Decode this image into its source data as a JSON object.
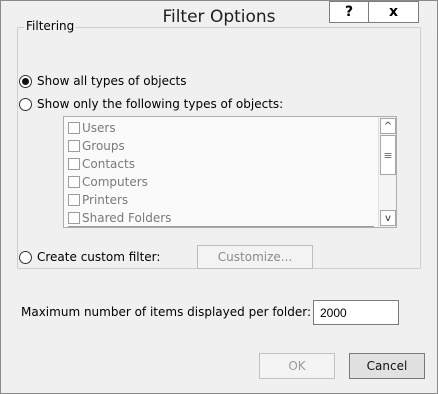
{
  "window": {
    "title": "Filter Options",
    "help_label": "?",
    "close_label": "x"
  },
  "filtering": {
    "group_label": "Filtering",
    "show_all_label": "Show all types of objects",
    "show_only_label": "Show only the following types of objects:",
    "selected_option": "show_all",
    "object_types": [
      "Users",
      "Groups",
      "Contacts",
      "Computers",
      "Printers",
      "Shared Folders"
    ],
    "custom_label": "Create custom filter:",
    "customize_label": "Customize...",
    "scroll_up_glyph": "^",
    "scroll_thumb_glyph": "≡",
    "scroll_down_glyph": "v"
  },
  "max_items": {
    "label": "Maximum number of items displayed per folder:",
    "value": "2000"
  },
  "buttons": {
    "ok": "OK",
    "cancel": "Cancel"
  }
}
